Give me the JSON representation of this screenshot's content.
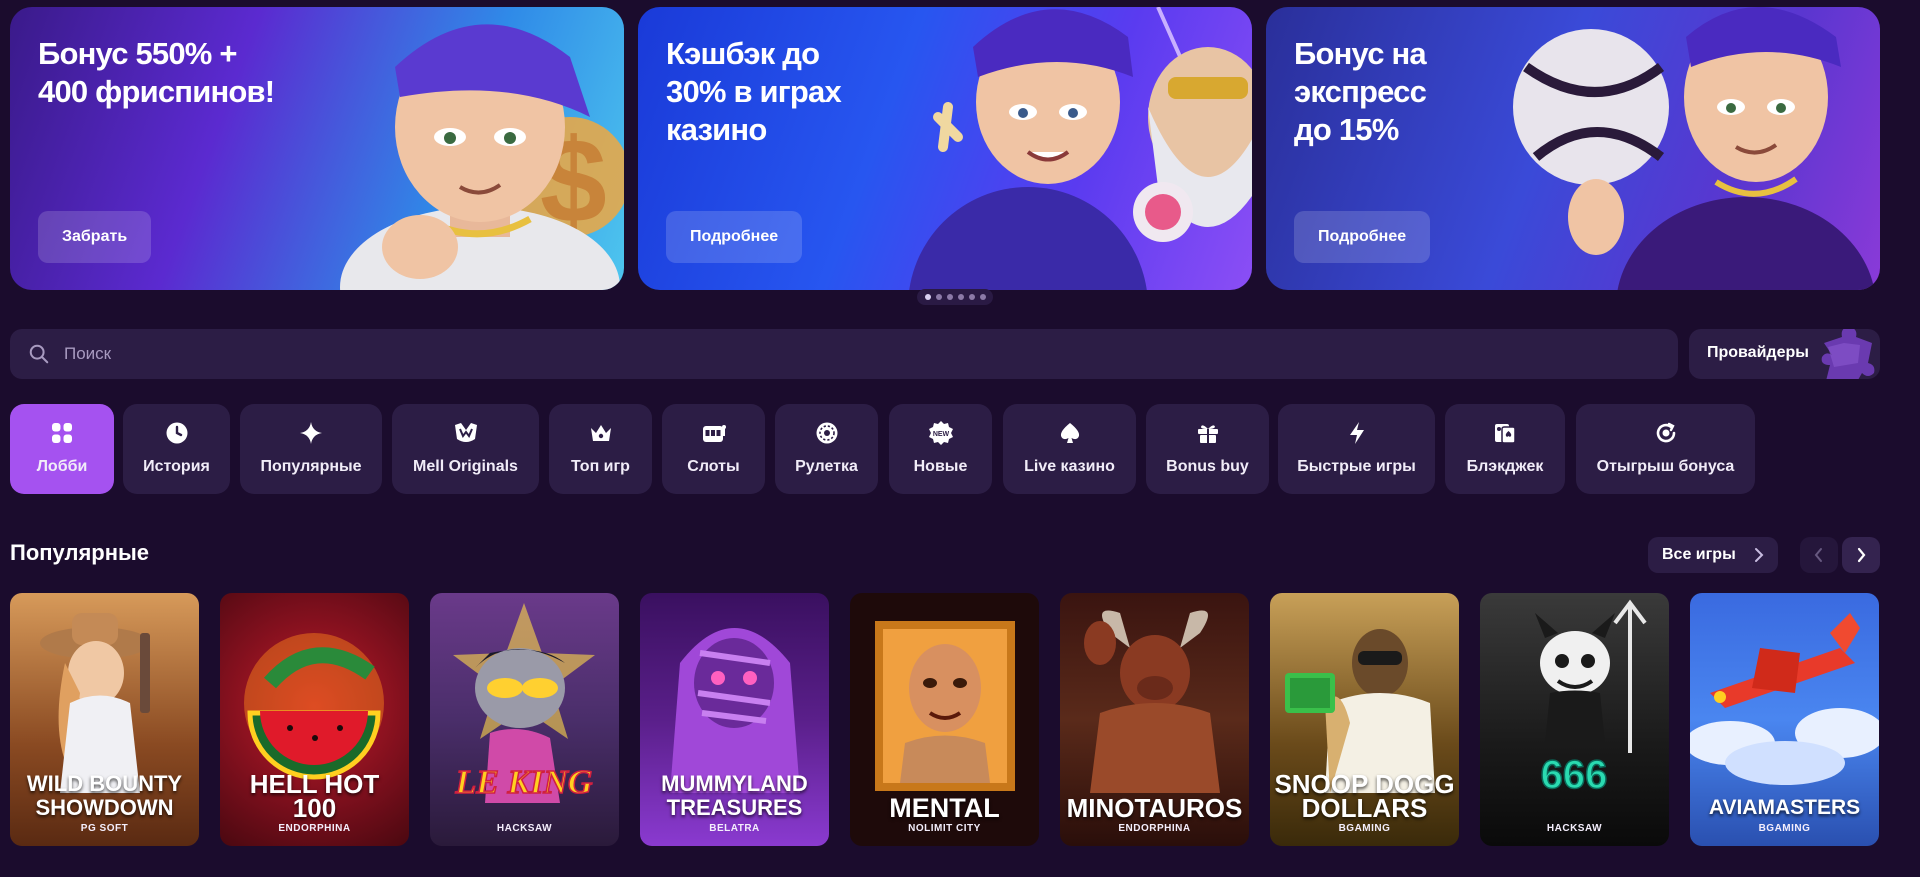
{
  "banners": [
    {
      "title": "Бонус 550% +\n400 фриспинов!",
      "button": "Забрать"
    },
    {
      "title": "Кэшбэк до\n30% в играх\nказино",
      "button": "Подробнее"
    },
    {
      "title": "Бонус на\nэкспресс\nдо 15%",
      "button": "Подробнее"
    }
  ],
  "search": {
    "placeholder": "Поиск",
    "icon": "search-icon"
  },
  "providers": {
    "label": "Провайдеры",
    "icon": "puzzle-icon"
  },
  "categories": [
    {
      "label": "Лобби",
      "icon": "grid-icon",
      "active": true
    },
    {
      "label": "История",
      "icon": "clock-icon"
    },
    {
      "label": "Популярные",
      "icon": "sparkle-icon"
    },
    {
      "label": "Mell Originals",
      "icon": "mell-logo-icon"
    },
    {
      "label": "Топ игр",
      "icon": "crown-icon"
    },
    {
      "label": "Слоты",
      "icon": "slot-machine-icon"
    },
    {
      "label": "Рулетка",
      "icon": "roulette-icon"
    },
    {
      "label": "Новые",
      "icon": "new-badge-icon"
    },
    {
      "label": "Live казино",
      "icon": "spade-icon"
    },
    {
      "label": "Bonus buy",
      "icon": "gift-icon"
    },
    {
      "label": "Быстрые игры",
      "icon": "lightning-icon"
    },
    {
      "label": "Блэкджек",
      "icon": "cards-icon"
    },
    {
      "label": "Отыгрыш бонуса",
      "icon": "bonus-refresh-icon"
    }
  ],
  "popular": {
    "title": "Популярные",
    "all_games": "Все игры",
    "games": [
      {
        "title": "WILD BOUNTY\nSHOWDOWN",
        "provider": "PG SOFT",
        "color": "#8a4a22"
      },
      {
        "title": "HELL HOT\n100",
        "provider": "ENDORPHINA",
        "color": "#7a0f1c"
      },
      {
        "title": "",
        "logo_text": "LE KING",
        "provider": "HACKSAW",
        "color": "#4a2e6a"
      },
      {
        "title": "MUMMYLAND\nTREASURES",
        "provider": "BELATRA",
        "color": "#5a1f8a"
      },
      {
        "title": "MENTAL",
        "provider": "NOLIMIT CITY",
        "color": "#2a0c0c"
      },
      {
        "title": "MINOTAUROS",
        "provider": "ENDORPHINA",
        "color": "#5a2a1a"
      },
      {
        "title": "SNOOP DOGG\nDOLLARS",
        "provider": "BGAMING",
        "color": "#6a4a1a"
      },
      {
        "title": "",
        "logo_text": "666",
        "provider": "HACKSAW",
        "color": "#1a1a1a"
      },
      {
        "title": "AVIAMASTERS",
        "provider": "BGAMING",
        "color": "#2a50b0"
      }
    ]
  }
}
